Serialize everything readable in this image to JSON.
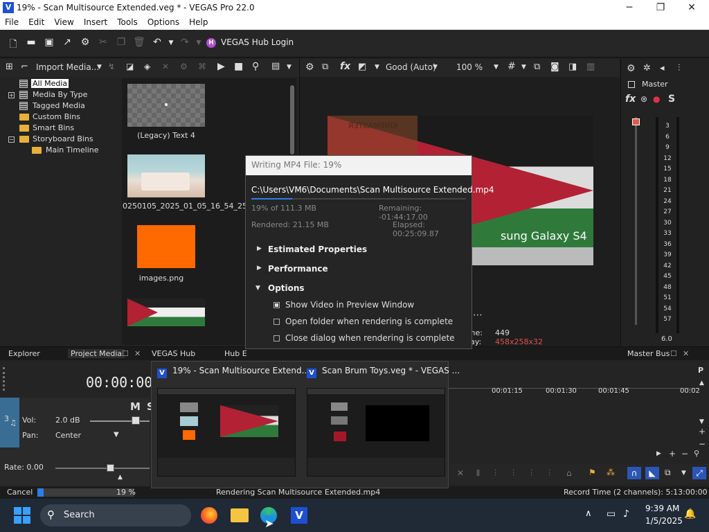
{
  "window": {
    "title": "19% - Scan Multisource Extended.veg * - VEGAS Pro 22.0",
    "logo": "V",
    "minimize": "─",
    "maximize": "❐",
    "close": "✕"
  },
  "menu": [
    "File",
    "Edit",
    "View",
    "Insert",
    "Tools",
    "Options",
    "Help"
  ],
  "toolbar": {
    "hub_label": "VEGAS Hub Login",
    "hub_glyph": "H"
  },
  "explorer": {
    "import_label": "Import Media...",
    "tree": [
      {
        "label": "All Media",
        "selected": true
      },
      {
        "label": "Media By Type",
        "expander": "+"
      },
      {
        "label": "Tagged Media"
      },
      {
        "label": "Custom Bins"
      },
      {
        "label": "Smart Bins"
      },
      {
        "label": "Storyboard Bins",
        "expander": "−"
      },
      {
        "label": "Main Timeline"
      }
    ],
    "media": [
      {
        "label": "(Legacy) Text 4"
      },
      {
        "label": "20250105_2025_01_05_16_54_25.mp4"
      },
      {
        "label": "images.png"
      }
    ]
  },
  "preview": {
    "quality": "Good (Auto)",
    "zoom": "100 %",
    "overlay_text": "sung Galaxy S4",
    "watermark": "KINEMASTER",
    "frame_label": "ame:",
    "frame_value": "449",
    "display_label": "play:",
    "display_value": "458x258x32"
  },
  "master": {
    "title": "Master",
    "fx": "fx",
    "s": "S",
    "scale": [
      "3",
      "6",
      "9",
      "12",
      "15",
      "18",
      "21",
      "24",
      "27",
      "30",
      "33",
      "36",
      "39",
      "42",
      "45",
      "48",
      "51",
      "54",
      "57"
    ],
    "gain": "6.0"
  },
  "tabs": {
    "explorer": "Explorer",
    "project_media": "Project Media",
    "vegas_hub": "VEGAS Hub",
    "hub_e": "Hub E",
    "master_bus": "Master Bus"
  },
  "timeline": {
    "timecode": "00:00:00.0",
    "track_number": "3",
    "mute": "M",
    "solo": "S",
    "vol_label": "Vol:",
    "vol_value": "2.0 dB",
    "pan_label": "Pan:",
    "pan_value": "Center",
    "rate_label": "Rate: 0.00",
    "ruler": [
      "00:01:15",
      "00:01:30",
      "00:01:45",
      "00:02"
    ]
  },
  "status": {
    "cancel": "Cancel",
    "progress_percent": 19,
    "progress_text": "19 %",
    "rendering": "Rendering Scan Multisource Extended.mp4",
    "record_time": "Record Time (2 channels): 5:13:00:00"
  },
  "dialog": {
    "title": "Writing MP4 File: 19%",
    "path": "C:\\Users\\VM6\\Documents\\Scan Multisource Extended.mp4",
    "progress_fraction": 0.19,
    "size": "19% of 111.3 MB",
    "remaining": "Remaining: -01:44:17.00",
    "rendered": "Rendered: 21.15 MB",
    "elapsed": "Elapsed: 00:25:09.87",
    "sections": [
      "Estimated Properties",
      "Performance",
      "Options"
    ],
    "options": [
      {
        "label": "Show Video in Preview Window",
        "checked": true
      },
      {
        "label": "Open folder when rendering is complete",
        "checked": false
      },
      {
        "label": "Close dialog when rendering is complete",
        "checked": false
      }
    ]
  },
  "switcher": {
    "items": [
      {
        "title": "19% - Scan Multisource Extend..."
      },
      {
        "title": "Scan Brum Toys.veg * - VEGAS ..."
      }
    ]
  },
  "taskbar": {
    "search": "Search",
    "time": "9:39 AM",
    "date": "1/5/2025",
    "vegas": "V"
  },
  "colors": {
    "accent": "#1f4fd1",
    "progress": "#2b7de9",
    "folder": "#e6b03a",
    "orange": "#ff6a00",
    "jordan_red": "#b22234",
    "jordan_green": "#2f7a3b"
  }
}
